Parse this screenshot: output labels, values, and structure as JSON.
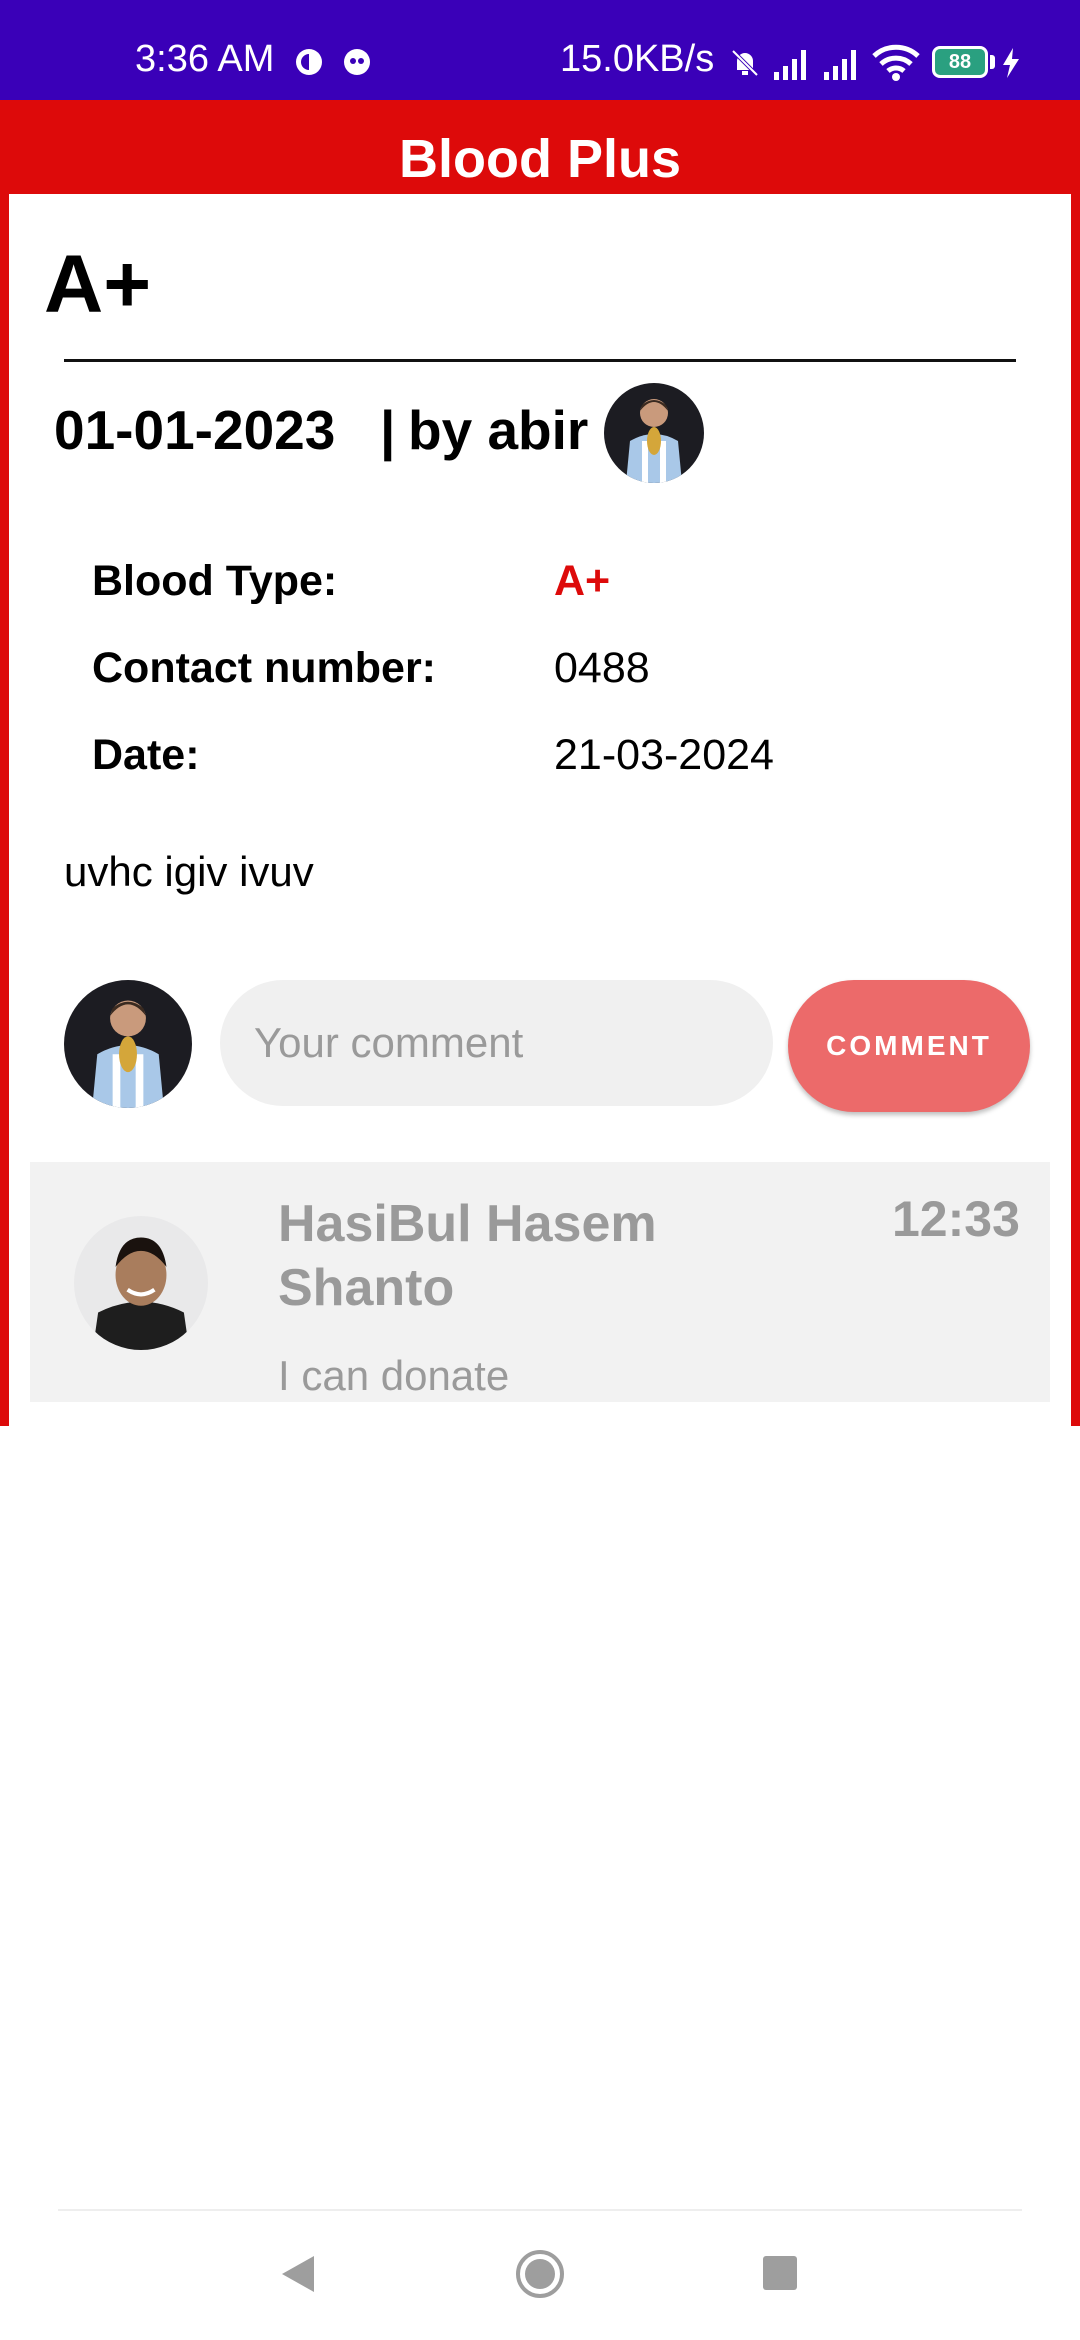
{
  "status_bar": {
    "time": "3:36 AM",
    "network_speed": "15.0KB/s",
    "battery": "88",
    "icons": [
      "notification-circle-icon",
      "notification-circle-icon",
      "mute-icon",
      "signal-icon",
      "signal-icon",
      "wifi-icon",
      "battery-icon",
      "charging-icon"
    ],
    "background_color": "#3a00b8"
  },
  "app_bar": {
    "title": "Blood Plus",
    "background_color": "#dd0a0a"
  },
  "post": {
    "blood_type_header": "A+",
    "date": "01-01-2023",
    "separator": "|",
    "author_line": "by abir",
    "details": {
      "blood_type_label": "Blood Type:",
      "blood_type_value": "A+",
      "contact_label": "Contact number:",
      "contact_value": "0488",
      "date_label": "Date:",
      "date_value": "21-03-2024"
    },
    "description": "uvhc igiv ivuv"
  },
  "comment_box": {
    "placeholder": "Your comment",
    "button_label": "COMMENT",
    "button_color": "#ec6a6a"
  },
  "comments": [
    {
      "name": "HasiBul Hasem Shanto",
      "time": "12:33",
      "text": "I can donate"
    }
  ]
}
